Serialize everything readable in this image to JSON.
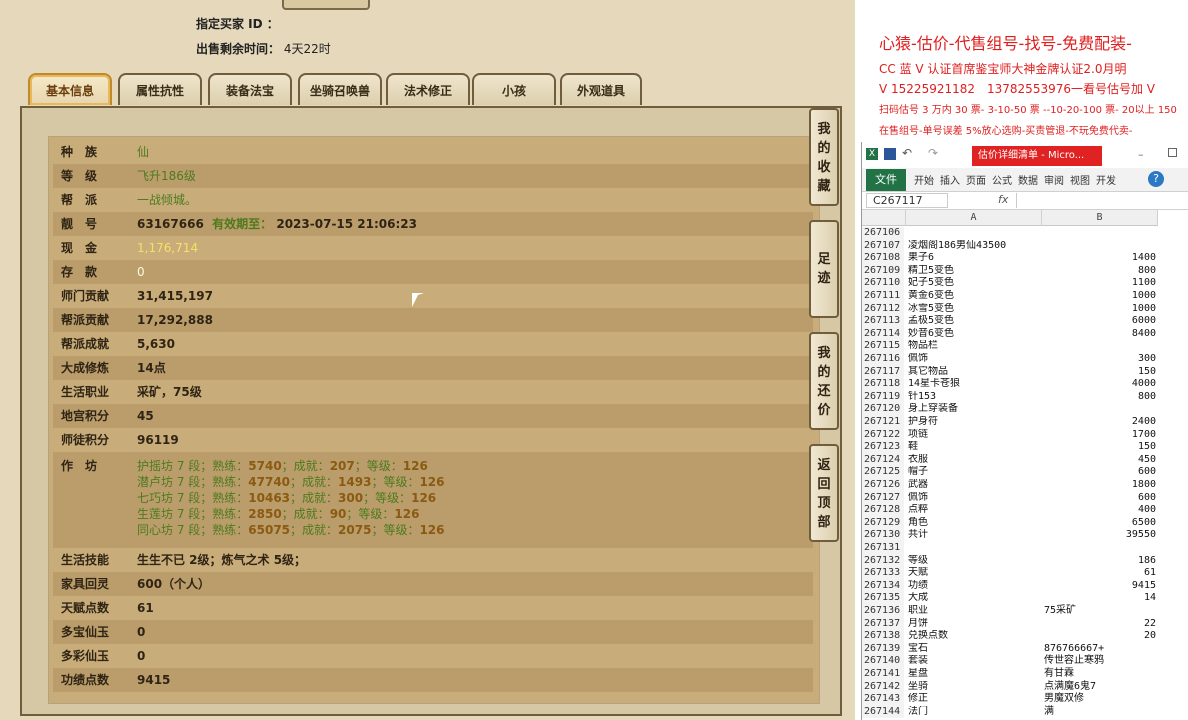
{
  "header": {
    "buyer_label": "指定买家 ID ：",
    "remain_label": "出售剩余时间：",
    "remain_value": "4天22时"
  },
  "tabs": [
    "基本信息",
    "属性抗性",
    "装备法宝",
    "坐骑召唤兽",
    "法术修正",
    "小孩",
    "外观道具"
  ],
  "info": {
    "race_k": "种　族",
    "race_v": "仙",
    "level_k": "等　级",
    "level_v": "飞升186级",
    "guild_k": "帮　派",
    "guild_v": "一战倾城。",
    "id_k": "靓　号",
    "id_v": "63167666",
    "id_valid_label": "有效期至：",
    "id_valid_v": "2023-07-15 21:06:23",
    "cash_k": "现　金",
    "cash_v": "1,176,714",
    "deposit_k": "存　款",
    "deposit_v": "0",
    "sect_k": "师门贡献",
    "sect_v": "31,415,197",
    "gcontrib_k": "帮派贡献",
    "gcontrib_v": "17,292,888",
    "gachieve_k": "帮派成就",
    "gachieve_v": "5,630",
    "dacheng_k": "大成修炼",
    "dacheng_v": "14点",
    "job_k": "生活职业",
    "job_v": "采矿，75级",
    "palace_k": "地宫积分",
    "palace_v": "45",
    "mentor_k": "师徒积分",
    "mentor_v": "96119",
    "craft_k": "作　坊",
    "craft_lines": [
      [
        "护摇坊 7 段；熟练：",
        "5740",
        "；成就：",
        "207",
        "；等级：",
        "126"
      ],
      [
        "潜卢坊 7 段；熟练：",
        "47740",
        "；成就：",
        "1493",
        "；等级：",
        "126"
      ],
      [
        "七巧坊 7 段；熟练：",
        "10463",
        "；成就：",
        "300",
        "；等级：",
        "126"
      ],
      [
        "生莲坊 7 段；熟练：",
        "2850",
        "；成就：",
        "90",
        "；等级：",
        "126"
      ],
      [
        "同心坊 7 段；熟练：",
        "65075",
        "；成就：",
        "2075",
        "；等级：",
        "126"
      ]
    ],
    "skill_k": "生活技能",
    "skill_v": "生生不已 2级；炼气之术 5级；",
    "furn_k": "家具回灵",
    "furn_v": "600（个人）",
    "talent_k": "天赋点数",
    "talent_v": "61",
    "dbjade_k": "多宝仙玉",
    "dbjade_v": "0",
    "dcjade_k": "多彩仙玉",
    "dcjade_v": "0",
    "merit_k": "功绩点数",
    "merit_v": "9415"
  },
  "side_buttons": [
    [
      "我",
      "的",
      "收",
      "藏"
    ],
    [
      "足",
      "迹"
    ],
    [
      "我",
      "的",
      "还",
      "价"
    ],
    [
      "返",
      "回",
      "顶",
      "部"
    ]
  ],
  "ad": {
    "line1": "心猿-估价-代售组号-找号-免费配装-",
    "line2": "CC 蓝 V 认证首席鉴宝师大神金牌认证2.0月明",
    "line3": "V 15225921182　13782553976一看号估号加 V",
    "line4": "扫码估号 3 万内 30 票- 3-10-50 票 --10-20-100 票- 20以上 150",
    "line5": "在售组号-单号误差 5%放心选购-买责管退-不玩免费代卖-"
  },
  "excel": {
    "title": "估价详细清单 - Micro...",
    "file_tab": "文件",
    "ribbon_tabs": [
      "开始",
      "插入",
      "页面",
      "公式",
      "数据",
      "审阅",
      "视图",
      "开发"
    ],
    "name_box": "C267117",
    "fx": "fx",
    "col_a": "A",
    "col_b": "B",
    "rows": [
      [
        "267106",
        "",
        ""
      ],
      [
        "267107",
        "凌烟阁186男仙43500",
        ""
      ],
      [
        "267108",
        "果子6",
        "1400"
      ],
      [
        "267109",
        "精卫5变色",
        "800"
      ],
      [
        "267110",
        "妃子5变色",
        "1100"
      ],
      [
        "267111",
        "黄金6变色",
        "1000"
      ],
      [
        "267112",
        "冰雪5变色",
        "1000"
      ],
      [
        "267113",
        "孟极5变色",
        "6000"
      ],
      [
        "267114",
        "妙音6变色",
        "8400"
      ],
      [
        "267115",
        "物品栏",
        ""
      ],
      [
        "267116",
        "佩饰",
        "300"
      ],
      [
        "267117",
        "其它物品",
        "150"
      ],
      [
        "267118",
        "14星卡苍狼",
        "4000"
      ],
      [
        "267119",
        "针153",
        "800"
      ],
      [
        "267120",
        "身上穿装备",
        ""
      ],
      [
        "267121",
        "护身符",
        "2400"
      ],
      [
        "267122",
        "项链",
        "1700"
      ],
      [
        "267123",
        "鞋",
        "150"
      ],
      [
        "267124",
        "衣服",
        "450"
      ],
      [
        "267125",
        "帽子",
        "600"
      ],
      [
        "267126",
        "武器",
        "1800"
      ],
      [
        "267127",
        "佩饰",
        "600"
      ],
      [
        "267128",
        "点粹",
        "400"
      ],
      [
        "267129",
        "角色",
        "6500"
      ],
      [
        "267130",
        "共计",
        "39550"
      ],
      [
        "267131",
        "",
        ""
      ],
      [
        "267132",
        "等级",
        "186"
      ],
      [
        "267133",
        "天赋",
        "61"
      ],
      [
        "267134",
        "功绩",
        "9415"
      ],
      [
        "267135",
        "大成",
        "14"
      ],
      [
        "267136",
        "职业",
        "75采矿"
      ],
      [
        "267137",
        "月饼",
        "22"
      ],
      [
        "267138",
        "兑换点数",
        "20"
      ],
      [
        "267139",
        "宝石",
        "876766667+"
      ],
      [
        "267140",
        "套装",
        "传世容止寒鸦"
      ],
      [
        "267141",
        "星盘",
        "有甘霖"
      ],
      [
        "267142",
        "坐骑",
        "点满魔6鬼7"
      ],
      [
        "267143",
        "修正",
        "男魔双修"
      ],
      [
        "267144",
        "法门",
        "满"
      ]
    ]
  }
}
